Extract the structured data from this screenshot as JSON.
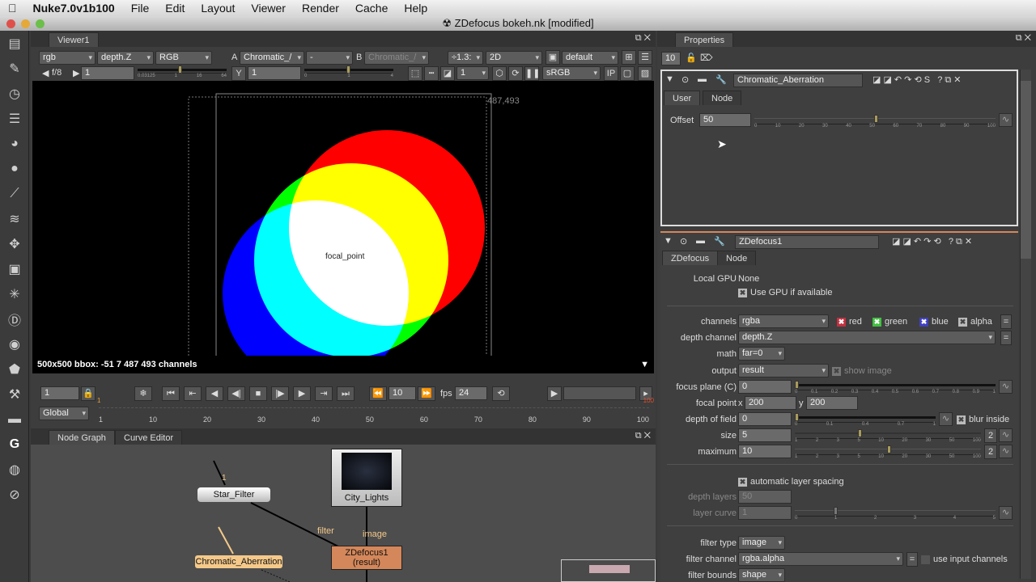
{
  "menubar": {
    "apple": "",
    "app": "Nuke7.0v1b100",
    "items": [
      "File",
      "Edit",
      "Layout",
      "Viewer",
      "Render",
      "Cache",
      "Help"
    ]
  },
  "window": {
    "title": "ZDefocus bokeh.nk [modified]"
  },
  "viewer": {
    "tab": "Viewer1",
    "channels": "rgb",
    "alpha_channel": "depth.Z",
    "display": "RGB",
    "a_label": "A",
    "a_input": "Chromatic_/",
    "op": "-",
    "b_label": "B",
    "b_input": "Chromatic_/",
    "zoom": "÷1.3:",
    "view_mode": "2D",
    "lut_layer": "default",
    "fstop": "f/8",
    "gain": "1",
    "gamma_label": "Y",
    "gamma": "1",
    "proxy": "1",
    "colorspace": "sRGB",
    "ip": "IP",
    "gain_ticks": [
      "0.03125",
      "1",
      "16",
      "64"
    ],
    "gamma_ticks": [
      "0",
      "1",
      "4"
    ],
    "coord": "487,493",
    "focal_label": "focal_point",
    "info": "500x500 bbox: -51 7 487 493 channels"
  },
  "playback": {
    "frame": "1",
    "increment": "10",
    "fps_label": "fps",
    "fps": "24",
    "range": "Global",
    "ruler": [
      "1",
      "10",
      "20",
      "30",
      "40",
      "50",
      "60",
      "70",
      "80",
      "90",
      "100"
    ],
    "in_marker": "1",
    "out_marker": "100"
  },
  "nodegraph": {
    "tabs": [
      "Node Graph",
      "Curve Editor"
    ],
    "nodes": {
      "star": "Star_Filter",
      "city": "City_Lights",
      "chroma": "Chromatic_Aberration",
      "zdefocus": "ZDefocus1",
      "zdefocus_sub": "(result)"
    },
    "edge_labels": {
      "filter": "filter",
      "image": "image",
      "one": "1"
    }
  },
  "properties": {
    "tab": "Properties",
    "max_panels": "10",
    "chroma": {
      "name": "Chromatic_Aberration",
      "tabs": [
        "User",
        "Node"
      ],
      "offset_label": "Offset",
      "offset": "50",
      "ticks": [
        "0",
        "10",
        "20",
        "30",
        "40",
        "50",
        "60",
        "70",
        "80",
        "90",
        "100"
      ],
      "offset_fraction": 0.5
    },
    "zdef": {
      "name": "ZDefocus1",
      "tabs": [
        "ZDefocus",
        "Node"
      ],
      "local_gpu_label": "Local GPU",
      "local_gpu": "None",
      "use_gpu": "Use GPU if available",
      "channels_label": "channels",
      "channels": "rgba",
      "red": "red",
      "green": "green",
      "blue": "blue",
      "alpha": "alpha",
      "depth_label": "depth channel",
      "depth": "depth.Z",
      "math_label": "math",
      "math": "far=0",
      "output_label": "output",
      "output": "result",
      "show_image": "show image",
      "focus_label": "focus plane (C)",
      "focus": "0",
      "focus_ticks": [
        "0",
        "0.1",
        "0.2",
        "0.3",
        "0.4",
        "0.5",
        "0.6",
        "0.7",
        "0.8",
        "0.9",
        "1"
      ],
      "focal_label": "focal point",
      "x_label": "x",
      "fx": "200",
      "y_label": "y",
      "fy": "200",
      "dof_label": "depth of field",
      "dof": "0",
      "dof_ticks": [
        "0",
        "0.1",
        "0.4",
        "0.7",
        "1"
      ],
      "blur_inside": "blur inside",
      "size_label": "size",
      "size": "5",
      "max_label": "maximum",
      "max": "10",
      "log_ticks": [
        "1",
        "2",
        "3",
        "5",
        "10",
        "20",
        "30",
        "50",
        "100"
      ],
      "two": "2",
      "auto_layer": "automatic layer spacing",
      "layers_label": "depth layers",
      "layers": "50",
      "curve_label": "layer curve",
      "curve": "1",
      "curve_ticks": [
        "0",
        "1",
        "2",
        "3",
        "4",
        "5"
      ],
      "ftype_label": "filter type",
      "ftype": "image",
      "fchan_label": "filter channel",
      "fchan": "rgba.alpha",
      "use_input": "use input channels",
      "fbounds_label": "filter bounds",
      "fbounds": "shape"
    }
  }
}
